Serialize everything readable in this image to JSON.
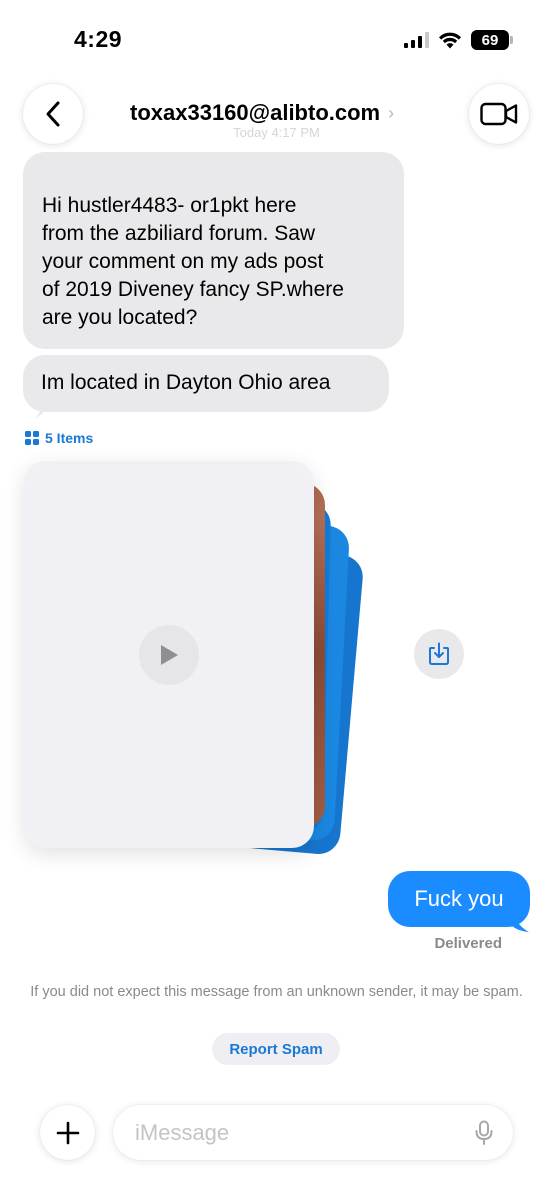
{
  "status_bar": {
    "time": "4:29",
    "battery": "69"
  },
  "header": {
    "contact": "toxax33160@alibto.com",
    "chevron": "›",
    "timestamp": "Today 4:17 PM"
  },
  "messages": {
    "incoming_1": {
      "lines": [
        " Hi hustler4483- or1pkt here",
        "from the azbiliard forum. Saw",
        "your comment on my ads post",
        "of 2019 Diveney fancy SP.where",
        "are you located?"
      ]
    },
    "incoming_2": {
      "text": "Im located in Dayton Ohio area"
    },
    "attachments": {
      "label": "5 Items"
    },
    "outgoing_1": {
      "text": "Fuck you",
      "status": "Delivered"
    }
  },
  "spam_notice": {
    "text": "If you did not expect this message from an unknown sender, it may be spam.",
    "button": "Report Spam"
  },
  "compose": {
    "placeholder": "iMessage"
  },
  "colors": {
    "accent": "#1a8cff",
    "incoming_bubble": "#e9e9eb",
    "link": "#1a78d6"
  },
  "icons": [
    "back-chevron-icon",
    "video-camera-icon",
    "grid-icon",
    "play-icon",
    "save-download-icon",
    "plus-icon",
    "microphone-icon"
  ]
}
